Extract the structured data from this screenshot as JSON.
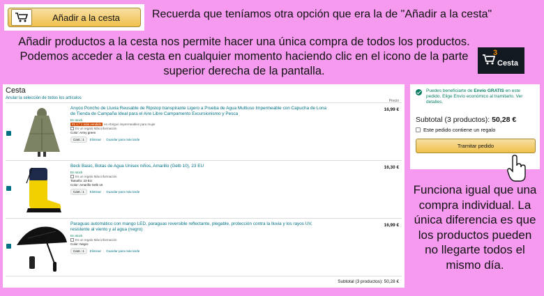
{
  "add_button": {
    "label": "Añadir a la cesta",
    "icon": "cart-icon"
  },
  "top_note": "Recuerda que teníamos otra opción que era la de \"Añadir a la cesta\"",
  "intro": "Añadir productos a la cesta nos permite hacer una única compra de todos los productos. Podemos acceder a la cesta en cualquier momento haciendo clic en el icono de la parte superior derecha de la pantalla.",
  "cart_logo": {
    "count": "3",
    "label": "Cesta",
    "icon": "cart-icon"
  },
  "cart": {
    "title": "Cesta",
    "deselect": "Anular la selección de todos los artículos",
    "price_header": "Precio",
    "items": [
      {
        "title": "Anyoo Poncho de Lluvia Reusable de Ripstop transpirante Ligero a Prueba de Agua Multiuso Impermeable con Capucha de Lona de Tienda de Campaña Ideal para el Aire Libre Campamento Excursionismo y Pesca",
        "price": "16,99 €",
        "stock": "En stock",
        "badge": "#1 n.º 1 más vendido",
        "badge_suffix": "en Abrigos impermeables para mujer",
        "gift": "Es un regalo Más información",
        "meta": "Color: Army green",
        "qty": "Cant.: 1",
        "delete": "Eliminar",
        "save": "Guardar para más tarde"
      },
      {
        "title": "Beck Basic, Botas de Agua Unisex niños, Amarillo (Gelb 10), 23 EU",
        "price": "16,30 €",
        "stock": "En stock",
        "gift": "Es un regalo Más información",
        "meta": "Tamaño: 23 EU",
        "meta2": "Color: Amarillo Gelb 10",
        "qty": "Cant.: 1",
        "delete": "Eliminar",
        "save": "Guardar para más tarde"
      },
      {
        "title": "Paraguas automático con mango LED, paraguas reversible reflectante, plegable, protección contra la lluvia y los rayos UV, resistente al viento y al agua (negro)",
        "price": "16,99 €",
        "stock": "En stock",
        "gift": "Es un regalo Más información",
        "meta": "Color: Negro",
        "qty": "Cant.: 1",
        "delete": "Eliminar",
        "save": "Guardar para más tarde"
      }
    ],
    "subtotal": "Subtotal (3 productos): 50,28 €"
  },
  "summary": {
    "ship_pre": "Puedes beneficiarte de ",
    "ship_bold": "Envío GRATIS",
    "ship_post": " en este pedido. Elige Envío económico al tramitarlo. Ver detalles.",
    "subtotal_label": "Subtotal (3 productos): ",
    "subtotal_value": "50,28 €",
    "gift": "Este pedido contiene un regalo",
    "checkout": "Tramitar pedido"
  },
  "side_note": "Funciona igual que una compra individual. La única diferencia es que los productos pueden no llegarte todos el mismo día.",
  "colors": {
    "background": "#f69af0",
    "link": "#007185",
    "button": "#f0c14b",
    "success": "#067d62"
  }
}
